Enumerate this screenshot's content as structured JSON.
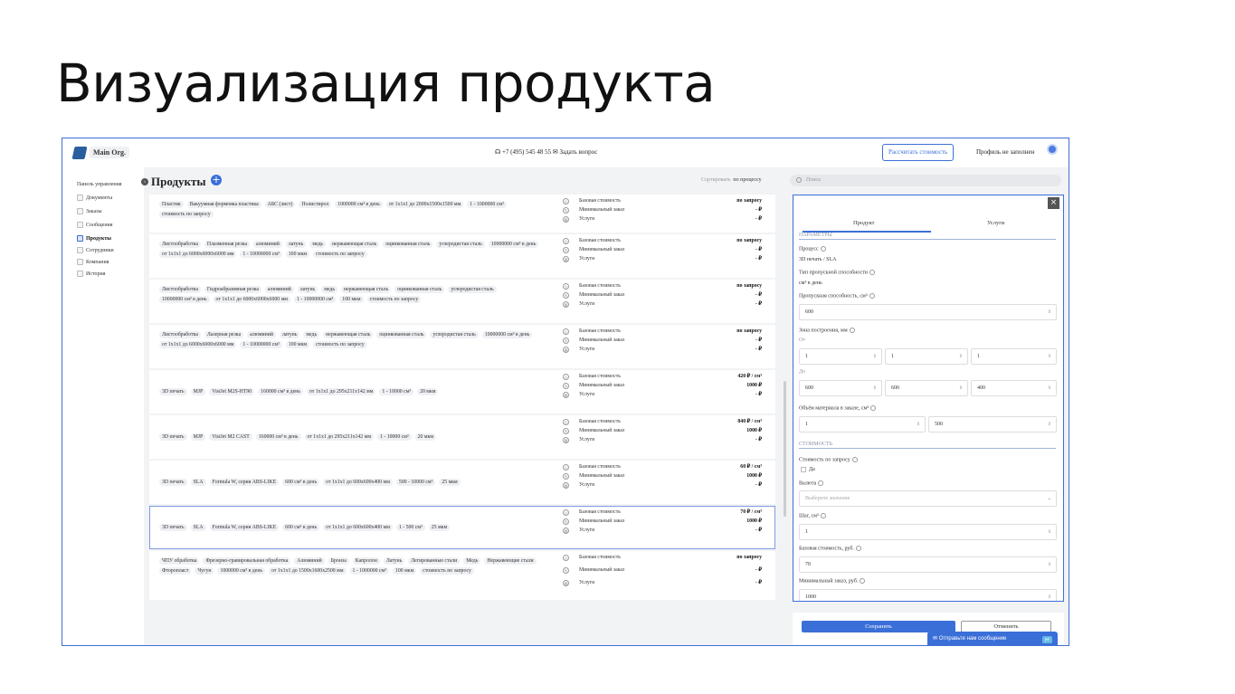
{
  "slide_title": "Визуализация продукта",
  "topbar": {
    "org_name": "Main Org.",
    "phone": "+7 (495) 545 48 55",
    "ask": "Задать вопрос",
    "calc_button": "Рассчитать стоимость",
    "profile": "Профиль не заполнен"
  },
  "sidebar": {
    "items": [
      {
        "label": "Панель управления"
      },
      {
        "label": "Документы"
      },
      {
        "label": "Заказы"
      },
      {
        "label": "Сообщения"
      },
      {
        "label": "Продукты"
      },
      {
        "label": "Сотрудники"
      },
      {
        "label": "Компания"
      },
      {
        "label": "История"
      }
    ]
  },
  "main": {
    "title": "Продукты",
    "sort_label": "Сортировать",
    "sort_value": "по процессу",
    "price_labels": {
      "base": "Базовая стоимость",
      "min": "Минимальный заказ",
      "services": "Услуги"
    },
    "products": [
      {
        "tags": [
          "Пластик",
          "Вакуумная формовка пластика",
          "АБС (лист)",
          "Полистирол",
          "1000000 см³ в день",
          "от 1x1x1 до 2000x1500x1500 мм",
          "1 - 1000000 см³",
          "стоимость по запросу"
        ],
        "base": "по запросу",
        "min": "- ₽",
        "services": "- ₽"
      },
      {
        "tags": [
          "Листообработка",
          "Плазменная резка",
          "алюминий",
          "латунь",
          "медь",
          "нержавеющая сталь",
          "оцинкованная сталь",
          "углеродистая сталь",
          "10000000 см³ в день",
          "от 1x1x1 до 6000x6000x6000 мм",
          "1 - 10000000 см³",
          "100 мкм",
          "стоимость по запросу"
        ],
        "base": "по запросу",
        "min": "- ₽",
        "services": "- ₽"
      },
      {
        "tags": [
          "Листообработка",
          "Гидроабразивная резка",
          "алюминий",
          "латунь",
          "медь",
          "нержавеющая сталь",
          "оцинкованная сталь",
          "углеродистая сталь",
          "10000000 см³ в день",
          "от 1x1x1 до 6000x6000x6000 мм",
          "1 - 10000000 см³",
          "100 мкм",
          "стоимость по запросу"
        ],
        "base": "по запросу",
        "min": "- ₽",
        "services": "- ₽"
      },
      {
        "tags": [
          "Листообработка",
          "Лазерная резка",
          "алюминий",
          "латунь",
          "медь",
          "нержавеющая сталь",
          "оцинкованная сталь",
          "углеродистая сталь",
          "10000000 см³ в день",
          "от 1x1x1 до 6000x6000x6000 мм",
          "1 - 10000000 см³",
          "100 мкм",
          "стоимость по запросу"
        ],
        "base": "по запросу",
        "min": "- ₽",
        "services": "- ₽"
      },
      {
        "tags": [
          "3D печать",
          "MJP",
          "VisiJet M2S-HT90",
          "160000 см³ в день",
          "от 1x1x1 до 295x211x142 мм",
          "1 - 10000 см³",
          "20 мкм"
        ],
        "base": "420 ₽ / см³",
        "min": "1000 ₽",
        "services": "- ₽"
      },
      {
        "tags": [
          "3D печать",
          "MJP",
          "VisiJet M2 CAST",
          "160000 см³ в день",
          "от 1x1x1 до 295x211x142 мм",
          "1 - 10000 см³",
          "20 мкм"
        ],
        "base": "840 ₽ / см³",
        "min": "1000 ₽",
        "services": "- ₽"
      },
      {
        "tags": [
          "3D печать",
          "SLA",
          "Formula W, серия ABS-LIKE",
          "600 см³ в день",
          "от 1x1x1 до 600x600x400 мм",
          "500 - 10000 см³",
          "25 мкм"
        ],
        "base": "60 ₽ / см³",
        "min": "1000 ₽",
        "services": "- ₽"
      },
      {
        "tags": [
          "3D печать",
          "SLA",
          "Formula W, серия ABS-LIKE",
          "600 см³ в день",
          "от 1x1x1 до 600x600x400 мм",
          "1 - 500 см³",
          "25 мкм"
        ],
        "base": "70 ₽ / см³",
        "min": "1000 ₽",
        "services": "- ₽"
      },
      {
        "tags": [
          "ЧПУ обработка",
          "Фрезерно-гравировальная обработка",
          "Алюминий",
          "Бронза",
          "Капролон",
          "Латунь",
          "Легированные стали",
          "Медь",
          "Нержавеющие стали",
          "Фторопласт",
          "Чугун",
          "1000000 см³ в день",
          "от 1x1x1 до 1500x1600x2500 мм",
          "1 - 1000000 см³",
          "100 мкм",
          "стоимость по запросу"
        ],
        "base": "по запросу",
        "min": "- ₽",
        "services": "- ₽"
      }
    ]
  },
  "search": {
    "placeholder": "Поиск"
  },
  "panel": {
    "tabs": [
      "Продукт",
      "Услуги"
    ],
    "section_params": "ПАРАМЕТРЫ",
    "process_label": "Процесс",
    "process_value": "3D печать / SLA",
    "throughput_type_label": "Тип пропускной способности",
    "throughput_type_value": "см³ в день",
    "throughput_label": "Пропускная способность, см³",
    "throughput_value": "600",
    "zone_label": "Зона построения, мм",
    "from_label": "От",
    "from_values": [
      "1",
      "1",
      "1"
    ],
    "to_label": "До",
    "to_values": [
      "600",
      "600",
      "400"
    ],
    "volume_label": "Объём материала в заказе, см³",
    "volume_values": [
      "1",
      "500"
    ],
    "section_cost": "СТОИМОСТЬ",
    "on_request_label": "Стоимость по запросу",
    "yes_label": "Да",
    "currency_label": "Валюта",
    "currency_placeholder": "Выберите значение",
    "step_label": "Шаг, см³",
    "step_value": "1",
    "base_cost_label": "Базовая стоимость, руб.",
    "base_cost_value": "70",
    "min_order_label": "Минимальный заказ, руб.",
    "min_order_value": "1000"
  },
  "footer": {
    "save": "Сохранить",
    "cancel": "Отменить"
  },
  "chat": {
    "label": "Отправьте нам сообщение",
    "status": "уе"
  }
}
